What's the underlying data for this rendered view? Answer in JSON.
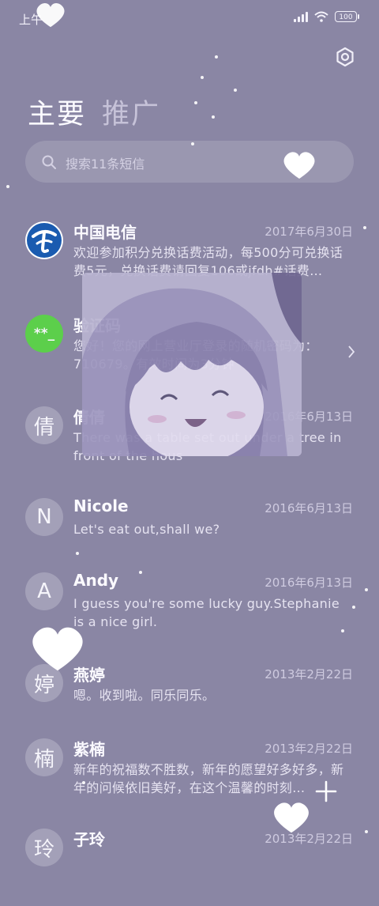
{
  "status": {
    "time": "上午",
    "battery": "100"
  },
  "tabs": {
    "main": "主要",
    "promo": "推广"
  },
  "search": {
    "placeholder": "搜索11条短信"
  },
  "messages": [
    {
      "name": "中国电信",
      "date": "2017年6月30日",
      "preview": "欢迎参加积分兑换话费活动，每500分可兑换话费5元，兑换话费请回复106或jfdh#话费…",
      "avatar": "telecom-logo"
    },
    {
      "name": "验证码",
      "date": "",
      "preview": "您好！您的网上营业厅登录的随机密码为：710679。有效时间为3分钟",
      "avatar_text": "**_",
      "avatar_color": "#5ccf4b"
    },
    {
      "name": "倩倩",
      "date": "2016年6月13日",
      "preview": "There was a table set out under a tree in front of the hous",
      "avatar_text": "倩"
    },
    {
      "name": "Nicole",
      "date": "2016年6月13日",
      "preview": "Let's eat out,shall we?",
      "avatar_text": "N"
    },
    {
      "name": "Andy",
      "date": "2016年6月13日",
      "preview": "I guess you're some lucky guy.Stephanie is a nice girl.",
      "avatar_text": "A"
    },
    {
      "name": "燕婷",
      "date": "2013年2月22日",
      "preview": "嗯。收到啦。同乐同乐。",
      "avatar_text": "婷"
    },
    {
      "name": "紫楠",
      "date": "2013年2月22日",
      "preview": "新年的祝福数不胜数，新年的愿望好多好多，新年的问候依旧美好，在这个温馨的时刻…",
      "avatar_text": "楠"
    },
    {
      "name": "子玲",
      "date": "2013年2月22日",
      "preview": "",
      "avatar_text": "玲"
    }
  ],
  "colors": {
    "background": "#8a86a4",
    "verify_avatar": "#5ccf4b",
    "telecom_blue": "#1a5bb0"
  }
}
